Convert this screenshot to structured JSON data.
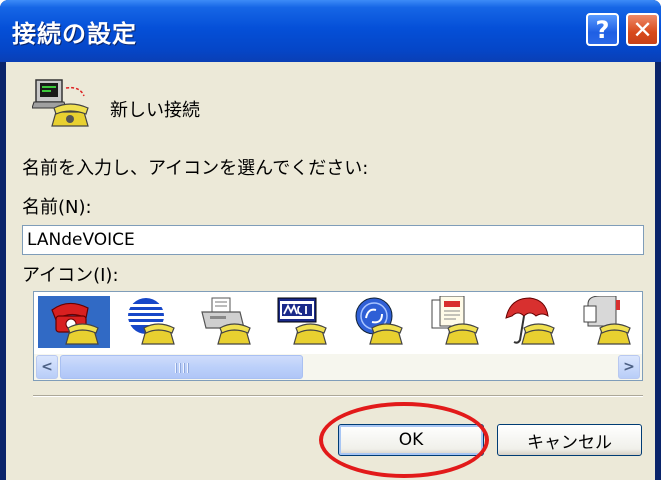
{
  "window": {
    "title": "接続の設定",
    "help_glyph": "?",
    "close_glyph": "✕"
  },
  "connection": {
    "name": "新しい接続"
  },
  "form": {
    "prompt": "名前を入力し、アイコンを選んでください:",
    "name_label": "名前(N):",
    "name_value": "LANdeVOICE",
    "icon_label": "アイコン(I):"
  },
  "icons": [
    {
      "name": "red-phone-icon",
      "selected": true
    },
    {
      "name": "globe-phone-icon",
      "selected": false
    },
    {
      "name": "fax-machine-icon",
      "selected": false
    },
    {
      "name": "mci-phone-icon",
      "selected": false
    },
    {
      "name": "ge-logo-phone-icon",
      "selected": false
    },
    {
      "name": "documents-phone-icon",
      "selected": false
    },
    {
      "name": "umbrella-phone-icon",
      "selected": false
    },
    {
      "name": "mailbox-phone-icon",
      "selected": false
    }
  ],
  "scrollbar": {
    "left_arrow": "<",
    "right_arrow": ">"
  },
  "buttons": {
    "ok": "OK",
    "cancel": "キャンセル"
  },
  "colors": {
    "title_bar": "#0550d8",
    "selection": "#316ac5",
    "highlight_circle": "#e21a1a"
  }
}
